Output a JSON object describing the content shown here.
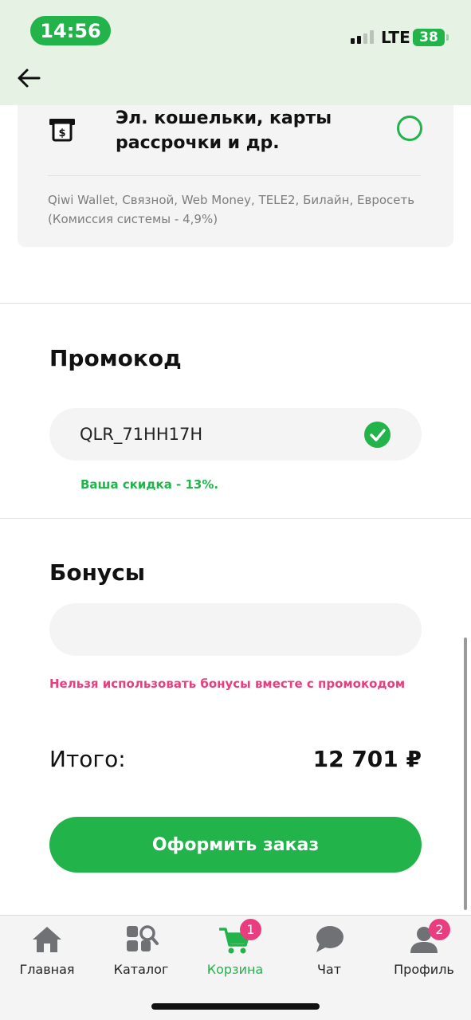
{
  "status_bar": {
    "time": "14:56",
    "network": "LTE",
    "battery": "38"
  },
  "payment_option": {
    "title": "Эл. кошельки, карты рассрочки и др.",
    "description": "Qiwi Wallet, Связной, Web Money, TELE2, Билайн, Евросеть (Комиссия системы - 4,9%)",
    "selected": false
  },
  "promo": {
    "title": "Промокод",
    "code": "QLR_71HH17H",
    "message": "Ваша скидка - 13%."
  },
  "bonuses": {
    "title": "Бонусы",
    "value": "",
    "warning": "Нельзя использовать бонусы вместе с промокодом"
  },
  "total": {
    "label": "Итого:",
    "value": "12 701 ₽"
  },
  "order_button": "Оформить заказ",
  "tabbar": [
    {
      "label": "Главная",
      "icon": "home-icon"
    },
    {
      "label": "Каталог",
      "icon": "catalog-search-icon"
    },
    {
      "label": "Корзина",
      "icon": "cart-icon",
      "badge": "1",
      "active": true
    },
    {
      "label": "Чат",
      "icon": "chat-icon"
    },
    {
      "label": "Профиль",
      "icon": "profile-icon",
      "badge": "2"
    }
  ],
  "colors": {
    "accent": "#22b34b",
    "warning": "#e83e7f",
    "header_bg": "#e6f2e4"
  }
}
